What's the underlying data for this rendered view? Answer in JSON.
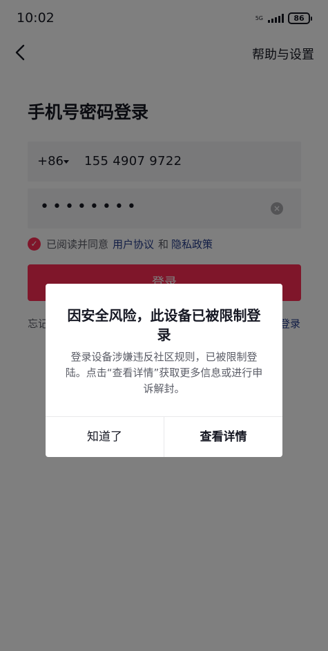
{
  "status_bar": {
    "time": "10:02",
    "network_label": "5G",
    "battery": "86"
  },
  "header": {
    "help_settings": "帮助与设置"
  },
  "login": {
    "title": "手机号密码登录",
    "country_code": "+86",
    "phone_number": "155 4907 9722",
    "password_mask": "••••••••",
    "agree_text": "已阅读并同意",
    "user_agreement": "用户协议",
    "and_text": "和",
    "privacy_policy": "隐私政策",
    "login_button": "登录",
    "forgot_text": "忘记",
    "other_login": "登录"
  },
  "dialog": {
    "title": "因安全风险，此设备已被限制登录",
    "body": "登录设备涉嫌违反社区规则，已被限制登陆。点击“查看详情”获取更多信息或进行申诉解封。",
    "dismiss_button": "知道了",
    "details_button": "查看详情"
  },
  "colors": {
    "accent": "#fe2c55",
    "link": "#233a8a"
  }
}
